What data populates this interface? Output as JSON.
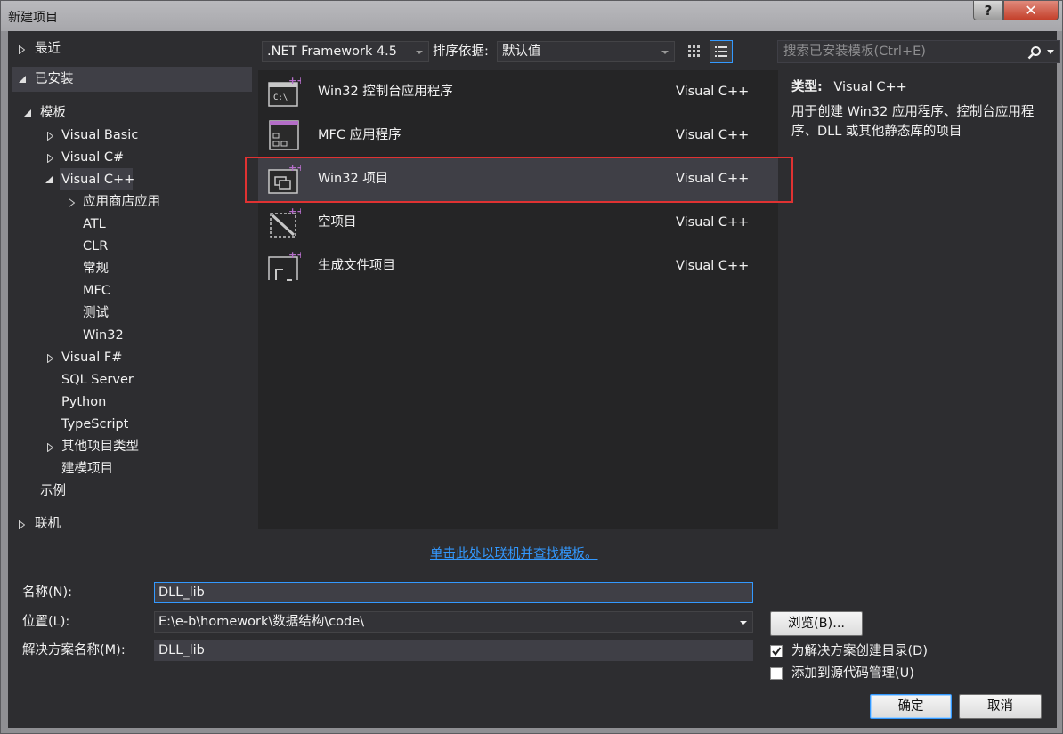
{
  "window": {
    "title": "新建项目",
    "help_label": "?",
    "close_label": "✕"
  },
  "tree": {
    "recent": "最近",
    "installed": "已安装",
    "templates": "模板",
    "visual_basic": "Visual Basic",
    "visual_csharp": "Visual C#",
    "visual_cpp": "Visual C++",
    "store_apps": "应用商店应用",
    "atl": "ATL",
    "clr": "CLR",
    "general": "常规",
    "mfc": "MFC",
    "test": "测试",
    "win32": "Win32",
    "visual_fsharp": "Visual F#",
    "sql_server": "SQL Server",
    "python": "Python",
    "typescript": "TypeScript",
    "other_types": "其他项目类型",
    "modeling": "建模项目",
    "samples": "示例",
    "online": "联机"
  },
  "toolbar": {
    "framework": ".NET Framework 4.5",
    "sort_label": "排序依据:",
    "sort_value": "默认值",
    "search_placeholder": "搜索已安装模板(Ctrl+E)"
  },
  "templates": [
    {
      "name": "Win32 控制台应用程序",
      "lang": "Visual C++",
      "icon": "console-app-icon"
    },
    {
      "name": "MFC 应用程序",
      "lang": "Visual C++",
      "icon": "mfc-app-icon"
    },
    {
      "name": "Win32 项目",
      "lang": "Visual C++",
      "icon": "win32-project-icon"
    },
    {
      "name": "空项目",
      "lang": "Visual C++",
      "icon": "empty-project-icon"
    },
    {
      "name": "生成文件项目",
      "lang": "Visual C++",
      "icon": "makefile-project-icon"
    }
  ],
  "info": {
    "type_label": "类型:",
    "type_value": "Visual C++",
    "description": "用于创建 Win32 应用程序、控制台应用程序、DLL 或其他静态库的项目"
  },
  "online_link": "单击此处以联机并查找模板。",
  "form": {
    "name_label": "名称(N):",
    "name_value": "DLL_lib",
    "location_label": "位置(L):",
    "location_value": "E:\\e-b\\homework\\数据结构\\code\\",
    "solution_label": "解决方案名称(M):",
    "solution_value": "DLL_lib",
    "browse_label": "浏览(B)...",
    "create_dir_label": "为解决方案创建目录(D)",
    "source_control_label": "添加到源代码管理(U)",
    "ok_label": "确定",
    "cancel_label": "取消"
  },
  "colors": {
    "background": "#2d2d30",
    "panel": "#252526",
    "selection": "#3f3f46",
    "accent": "#3399ff",
    "highlight_box": "#e03232",
    "cpp_purple": "#b46ec8"
  }
}
